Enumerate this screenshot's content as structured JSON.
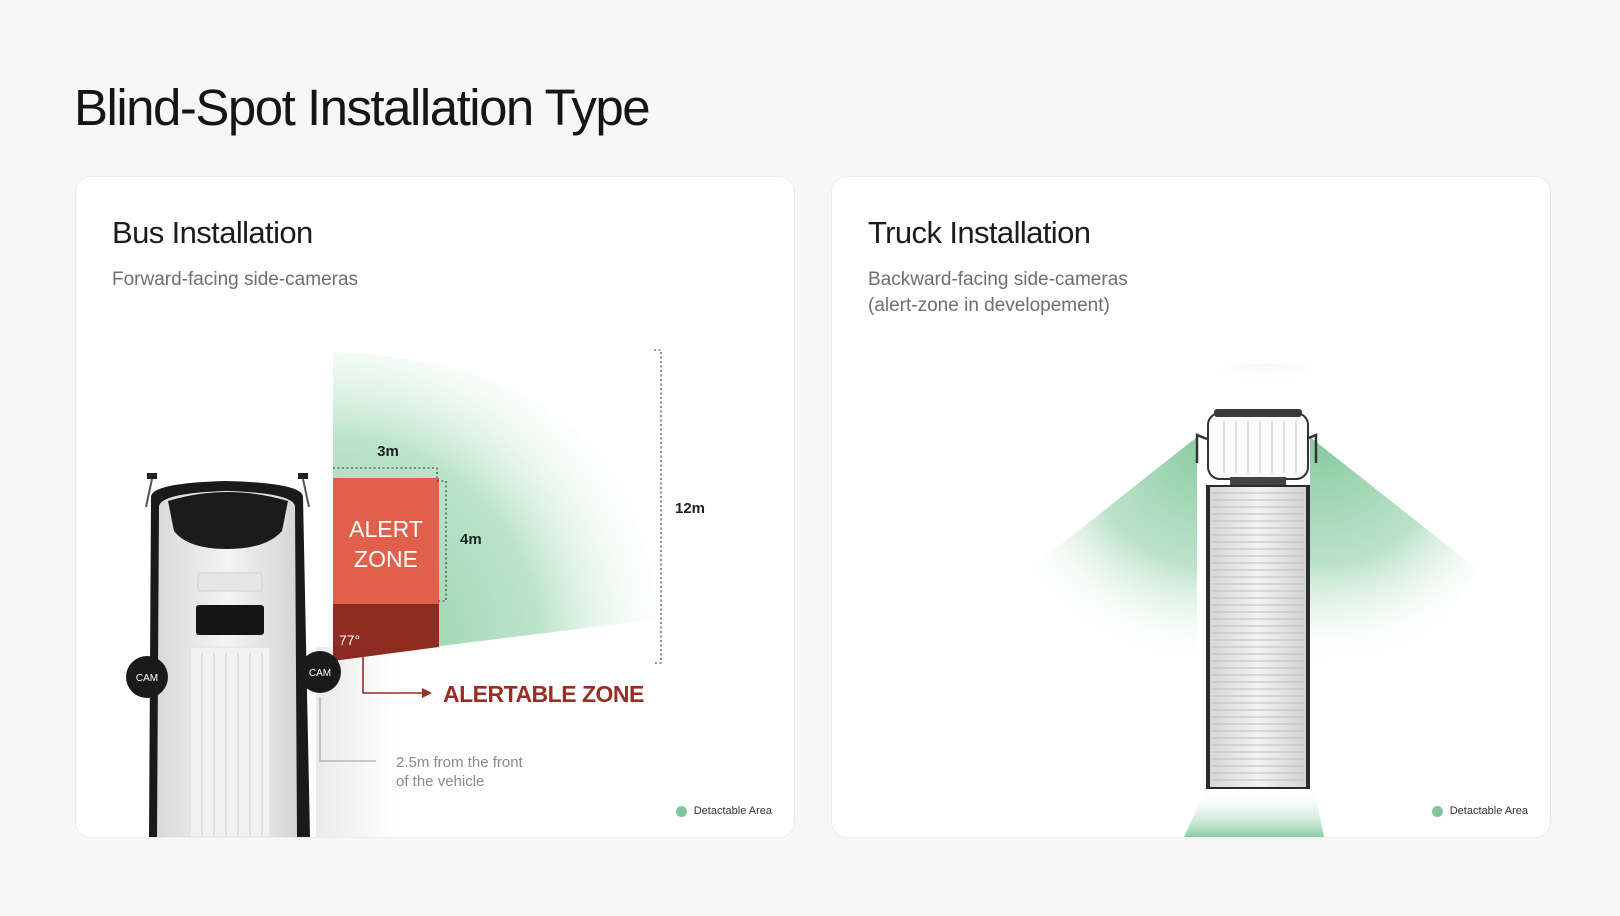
{
  "page": {
    "title": "Blind-Spot Installation Type"
  },
  "bus": {
    "title": "Bus Installation",
    "subtitle": "Forward-facing side-cameras",
    "width_label": "3m",
    "depth_label": "4m",
    "range_label": "12m",
    "alert_zone_line1": "ALERT",
    "alert_zone_line2": "ZONE",
    "angle_label": "77°",
    "alertable_zone_label": "ALERTABLE ZONE",
    "cam_label": "CAM",
    "note_line1": "2.5m from the front",
    "note_line2": "of the vehicle",
    "legend": "Detactable Area"
  },
  "truck": {
    "title": "Truck Installation",
    "subtitle": "Backward-facing side-cameras\n(alert-zone in developement)",
    "legend": "Detactable Area"
  },
  "colors": {
    "detectable_green": "#7fc79a",
    "alert_zone": "#e0604c",
    "alertable_zone": "#8f2c22",
    "alertable_text": "#9a2e24"
  }
}
